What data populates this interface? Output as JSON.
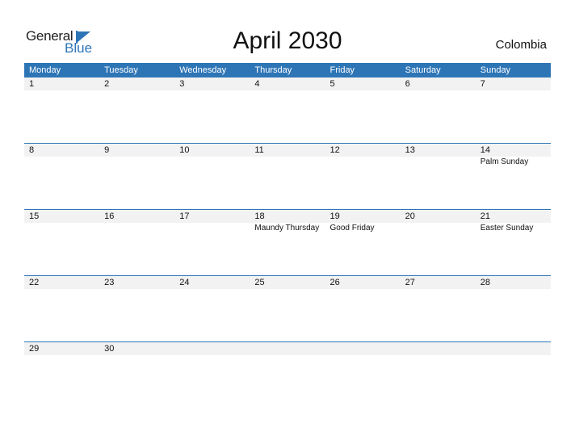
{
  "logo": {
    "general": "General",
    "blue": "Blue"
  },
  "title": "April 2030",
  "country": "Colombia",
  "colors": {
    "accent": "#2E75B6",
    "day_row_bg": "#F2F2F2"
  },
  "weekdays": [
    "Monday",
    "Tuesday",
    "Wednesday",
    "Thursday",
    "Friday",
    "Saturday",
    "Sunday"
  ],
  "weeks": [
    {
      "days": [
        "1",
        "2",
        "3",
        "4",
        "5",
        "6",
        "7"
      ],
      "events": [
        "",
        "",
        "",
        "",
        "",
        "",
        ""
      ]
    },
    {
      "days": [
        "8",
        "9",
        "10",
        "11",
        "12",
        "13",
        "14"
      ],
      "events": [
        "",
        "",
        "",
        "",
        "",
        "",
        "Palm Sunday"
      ]
    },
    {
      "days": [
        "15",
        "16",
        "17",
        "18",
        "19",
        "20",
        "21"
      ],
      "events": [
        "",
        "",
        "",
        "Maundy Thursday",
        "Good Friday",
        "",
        "Easter Sunday"
      ]
    },
    {
      "days": [
        "22",
        "23",
        "24",
        "25",
        "26",
        "27",
        "28"
      ],
      "events": [
        "",
        "",
        "",
        "",
        "",
        "",
        ""
      ]
    },
    {
      "days": [
        "29",
        "30",
        "",
        "",
        "",
        "",
        ""
      ],
      "events": [
        "",
        "",
        "",
        "",
        "",
        "",
        ""
      ]
    }
  ]
}
